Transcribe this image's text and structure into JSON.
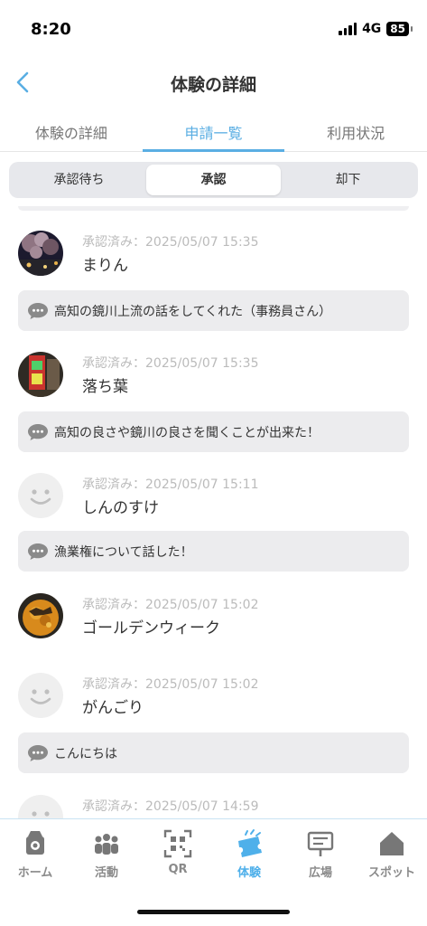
{
  "status_bar": {
    "time": "8:20",
    "network": "4G",
    "battery": "85"
  },
  "header": {
    "title": "体験の詳細",
    "back_icon": "chevron-left-icon",
    "accent": "#5aaee3"
  },
  "tabs": [
    {
      "label": "体験の詳細",
      "active": false
    },
    {
      "label": "申請一覧",
      "active": true
    },
    {
      "label": "利用状況",
      "active": false
    }
  ],
  "segments": [
    {
      "label": "承認待ち",
      "active": false
    },
    {
      "label": "承認",
      "active": true
    },
    {
      "label": "却下",
      "active": false
    }
  ],
  "entries": [
    {
      "status": "承認済み：2025/05/07 15:35",
      "name": "まりん",
      "avatar": "photo-night-blossoms",
      "comment": "高知の鏡川上流の話をしてくれた（事務員さん）"
    },
    {
      "status": "承認済み：2025/05/07 15:35",
      "name": "落ち葉",
      "avatar": "photo-neon-sign",
      "comment": "高知の良さや鏡川の良さを聞くことが出来た！"
    },
    {
      "status": "承認済み：2025/05/07 15:11",
      "name": "しんのすけ",
      "avatar": "default-face",
      "comment": "漁業権について話した！"
    },
    {
      "status": "承認済み：2025/05/07 15:02",
      "name": "ゴールデンウィーク",
      "avatar": "photo-food",
      "comment": null
    },
    {
      "status": "承認済み：2025/05/07 15:02",
      "name": "がんごり",
      "avatar": "default-face",
      "comment": "こんにちは"
    },
    {
      "status": "承認済み：2025/05/07 14:59",
      "name": "",
      "avatar": "default-face",
      "comment": null
    }
  ],
  "bottom_nav": [
    {
      "label": "ホーム",
      "icon": "home-camera-icon",
      "active": false
    },
    {
      "label": "活動",
      "icon": "people-icon",
      "active": false
    },
    {
      "label": "QR",
      "icon": "qr-scan-icon",
      "active": false
    },
    {
      "label": "体験",
      "icon": "ticket-icon",
      "active": true
    },
    {
      "label": "広場",
      "icon": "signboard-icon",
      "active": false
    },
    {
      "label": "スポット",
      "icon": "house-icon",
      "active": false
    }
  ]
}
